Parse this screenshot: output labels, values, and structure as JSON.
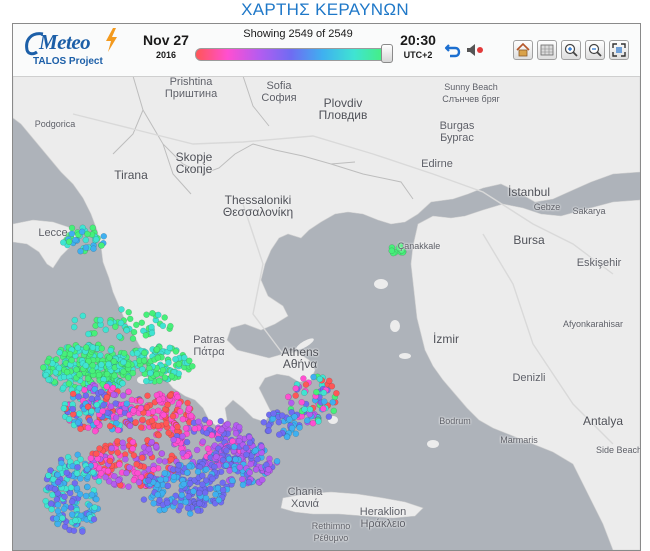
{
  "page_title": "ΧΑΡΤΗΣ ΚΕΡΑΥΝΩΝ",
  "logo": {
    "word": "Meteo",
    "subtitle": "TALOS Project"
  },
  "date": {
    "day": "Nov 27",
    "year": "2016"
  },
  "strike_count": {
    "text": "Showing 2549 of 2549",
    "shown": 2549,
    "total": 2549
  },
  "time": {
    "clock": "20:30",
    "timezone": "UTC+2"
  },
  "toolbar_icons": [
    "replay-icon",
    "sound-icon",
    "home-icon",
    "layers-icon",
    "zoom-in-icon",
    "zoom-out-icon",
    "fullscreen-icon"
  ],
  "colors": {
    "sea": "#aeb3ba",
    "land": "#ececec",
    "title": "#1f78c8",
    "brand": "#1c5fa8"
  },
  "strike_colors": [
    "#46f07a",
    "#3fe4d2",
    "#3fb0f0",
    "#6f6cf2",
    "#b45cf0",
    "#ff4fd1",
    "#ff5656"
  ],
  "places": {
    "pristina": "Prishtina\nПриштина",
    "sofia": "Sofia\nСофия",
    "plovdiv": "Plovdiv\nПловдив",
    "sunny_beach": "Sunny Beach\nСлънчев бряг",
    "burgas": "Burgas\nБургас",
    "podgorica": "Podgorica",
    "skopje": "Skopje\nСкопје",
    "edirne": "Edirne",
    "tirana": "Tirana",
    "istanbul": "İstanbul",
    "gebze": "Gebze",
    "sakarya": "Sakarya",
    "thessaloniki": "Thessaloniki\nΘεσσαλονίκη",
    "lecce": "Lecce",
    "canakkale": "Çanakkale",
    "bursa": "Bursa",
    "eskisehir": "Eskişehir",
    "afyonkarahisar": "Afyonkarahisar",
    "patras": "Patras\nΠάτρα",
    "athens": "Athens\nΑθήνα",
    "izmir": "İzmir",
    "denizli": "Denizli",
    "bodrum": "Bodrum",
    "marmaris": "Marmaris",
    "antalya": "Antalya",
    "side_beach": "Side Beach",
    "chania": "Chania\nΧανιά",
    "heraklion": "Heraklion\nΗράκλειο",
    "rethimno": "Rethimno\nΡέθυμνο"
  }
}
